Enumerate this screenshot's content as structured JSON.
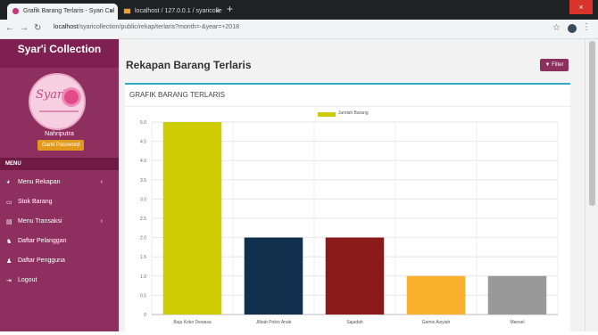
{
  "browser": {
    "tab1_title": "Grafik Barang Terlaris - Syari Col",
    "tab2_title": "localhost / 127.0.0.1 / syaricolle",
    "url_host": "localhost",
    "url_path": "/syaricollection/public/rekap/terlaris?month=-&year=+2018",
    "close_glyph": "×"
  },
  "sidebar": {
    "brand": "Syar'i Collection",
    "logo_text": "Syar'i",
    "user_name": "Nahriputra",
    "change_password": "Ganti Password",
    "menu_header": "MENU",
    "items": [
      {
        "label": "Menu Rekapan",
        "icon": "pie-chart-icon"
      },
      {
        "label": "Stok Barang",
        "icon": "box-icon"
      },
      {
        "label": "Menu Transaksi",
        "icon": "document-icon"
      },
      {
        "label": "Daftar Pelanggan",
        "icon": "users-icon"
      },
      {
        "label": "Daftar Pengguna",
        "icon": "user-icon"
      },
      {
        "label": "Logout",
        "icon": "logout-icon"
      }
    ]
  },
  "content": {
    "page_title": "Rekapan Barang Terlaris",
    "filter_label": "Filter",
    "box_title": "GRAFIK BARANG TERLARIS"
  },
  "chart_data": {
    "type": "bar",
    "categories": [
      "Baju Koko Dewasa",
      "Jilbab Polos Anak",
      "Sajadah",
      "Gamis Aisyiah",
      "Mansel"
    ],
    "series": [
      {
        "name": "Jumlah Barang",
        "values": [
          5,
          2,
          2,
          1,
          1
        ]
      }
    ],
    "bar_colors": [
      "#cccc00",
      "#11304e",
      "#8b1a1a",
      "#fab22e",
      "#999999"
    ],
    "ylim": [
      0,
      5
    ],
    "yticks": [
      "5.0",
      "4.5",
      "4.0",
      "3.5",
      "3.0",
      "2.5",
      "2.0",
      "1.5",
      "1.0",
      "0.5",
      "0"
    ],
    "legend_position": "top-center",
    "grid": true
  },
  "colors": {
    "sidebar": "#8d2f5f",
    "accent": "#37a7c7",
    "button_warning": "#e39a1c"
  }
}
